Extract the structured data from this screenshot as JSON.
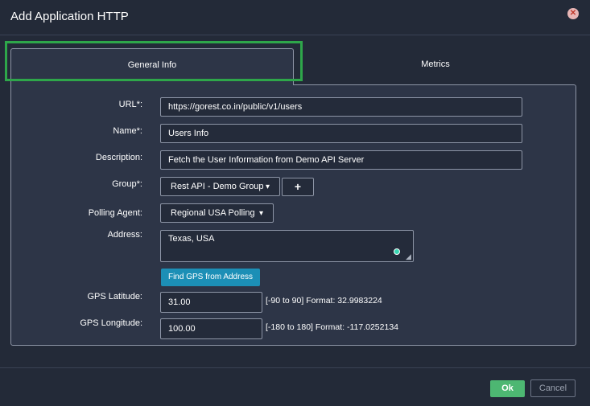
{
  "dialog": {
    "title": "Add Application HTTP",
    "close_icon": "close-icon"
  },
  "tabs": [
    {
      "label": "General Info",
      "active": true
    },
    {
      "label": "Metrics",
      "active": false
    }
  ],
  "form": {
    "url": {
      "label": "URL*:",
      "value": "https://gorest.co.in/public/v1/users"
    },
    "name": {
      "label": "Name*:",
      "value": "Users Info"
    },
    "description": {
      "label": "Description:",
      "value": "Fetch the User Information  from Demo API Server"
    },
    "group": {
      "label": "Group*:",
      "value": "Rest API - Demo Group",
      "add_icon": "plus-icon"
    },
    "polling_agent": {
      "label": "Polling Agent:",
      "value": "Regional USA Polling"
    },
    "address": {
      "label": "Address:",
      "value": "Texas, USA"
    },
    "find_gps_button": "Find GPS from Address",
    "latitude": {
      "label": "GPS Latitude:",
      "value": "31.00",
      "hint": "[-90 to 90]   Format: 32.9983224"
    },
    "longitude": {
      "label": "GPS Longitude:",
      "value": "100.00",
      "hint": "[-180 to 180]   Format: -117.0252134"
    }
  },
  "footer": {
    "ok_label": "Ok",
    "cancel_label": "Cancel"
  },
  "colors": {
    "accent_green": "#4db772",
    "highlight_green": "#2ea64a",
    "gps_button_blue": "#1c8fb6",
    "background": "#232a38"
  }
}
